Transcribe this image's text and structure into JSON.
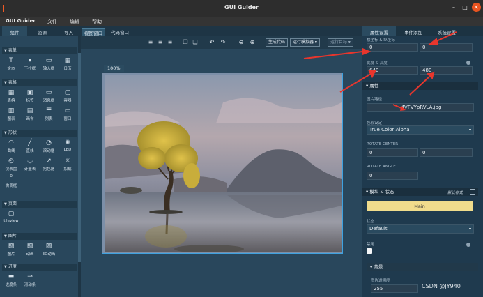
{
  "window": {
    "title": "GUI Guider"
  },
  "menubar": {
    "app": "GUI Guider",
    "items": [
      "文件",
      "编辑",
      "帮助"
    ]
  },
  "left_tabs": [
    "组件",
    "资源",
    "导入"
  ],
  "widget_sections": [
    {
      "title": "表单",
      "items": [
        "文本",
        "下拉框",
        "输入框",
        "日历"
      ]
    },
    {
      "title": "表格",
      "items": [
        "表格",
        "标签",
        "消息框",
        "容器",
        "图表",
        "画布",
        "列表",
        "窗口"
      ]
    },
    {
      "title": "形状",
      "items": [
        "曲线",
        "直线",
        "滚动框",
        "LED",
        "仪表盘",
        "计量表",
        "拾色器",
        "加载",
        "微调框"
      ]
    },
    {
      "title": "页面",
      "items": [
        "tileview"
      ]
    },
    {
      "title": "图片",
      "items": [
        "图片",
        "动画",
        "3D动画"
      ]
    },
    {
      "title": "进度",
      "items": [
        "进度条",
        "滑动条"
      ]
    }
  ],
  "canvas_tabs": [
    "视图窗口",
    "代码窗口"
  ],
  "toolbar": {
    "generate_code": "生成代码",
    "run_emulator": "运行模拟器",
    "run_target": "运行目标"
  },
  "canvas": {
    "zoom": "100%"
  },
  "right_tabs": [
    "属性设置",
    "事件添加",
    "系统设置"
  ],
  "properties": {
    "position_label": "横坐标 & 纵坐标",
    "x": "0",
    "y": "0",
    "size_label": "宽度 & 高度",
    "width": "640",
    "height": "480",
    "attributes_section": "属性",
    "image_path_label": "图片路径",
    "image_path": "4VFVYpRVLA.jpg",
    "color_key_label": "色彩设定",
    "color_key": "True Color Alpha",
    "rotate_center_label": "ROTATE CENTER",
    "rotate_center_x": "0",
    "rotate_center_y": "0",
    "rotate_angle_label": "ROTATE ANGLE",
    "rotate_angle": "0",
    "style_section": "模块 & 状态",
    "default_style_label": "默认样式",
    "main_button": "Main",
    "state_label": "状态",
    "state": "Default",
    "disable_label": "禁用",
    "background_section": "背景",
    "opacity_label": "图片透明度",
    "opacity": "255"
  },
  "watermark": "CSDN @JY940",
  "colors": {
    "accent": "#3fa2e0",
    "arrow": "#e8362d",
    "main_button": "#f0dc8c"
  }
}
